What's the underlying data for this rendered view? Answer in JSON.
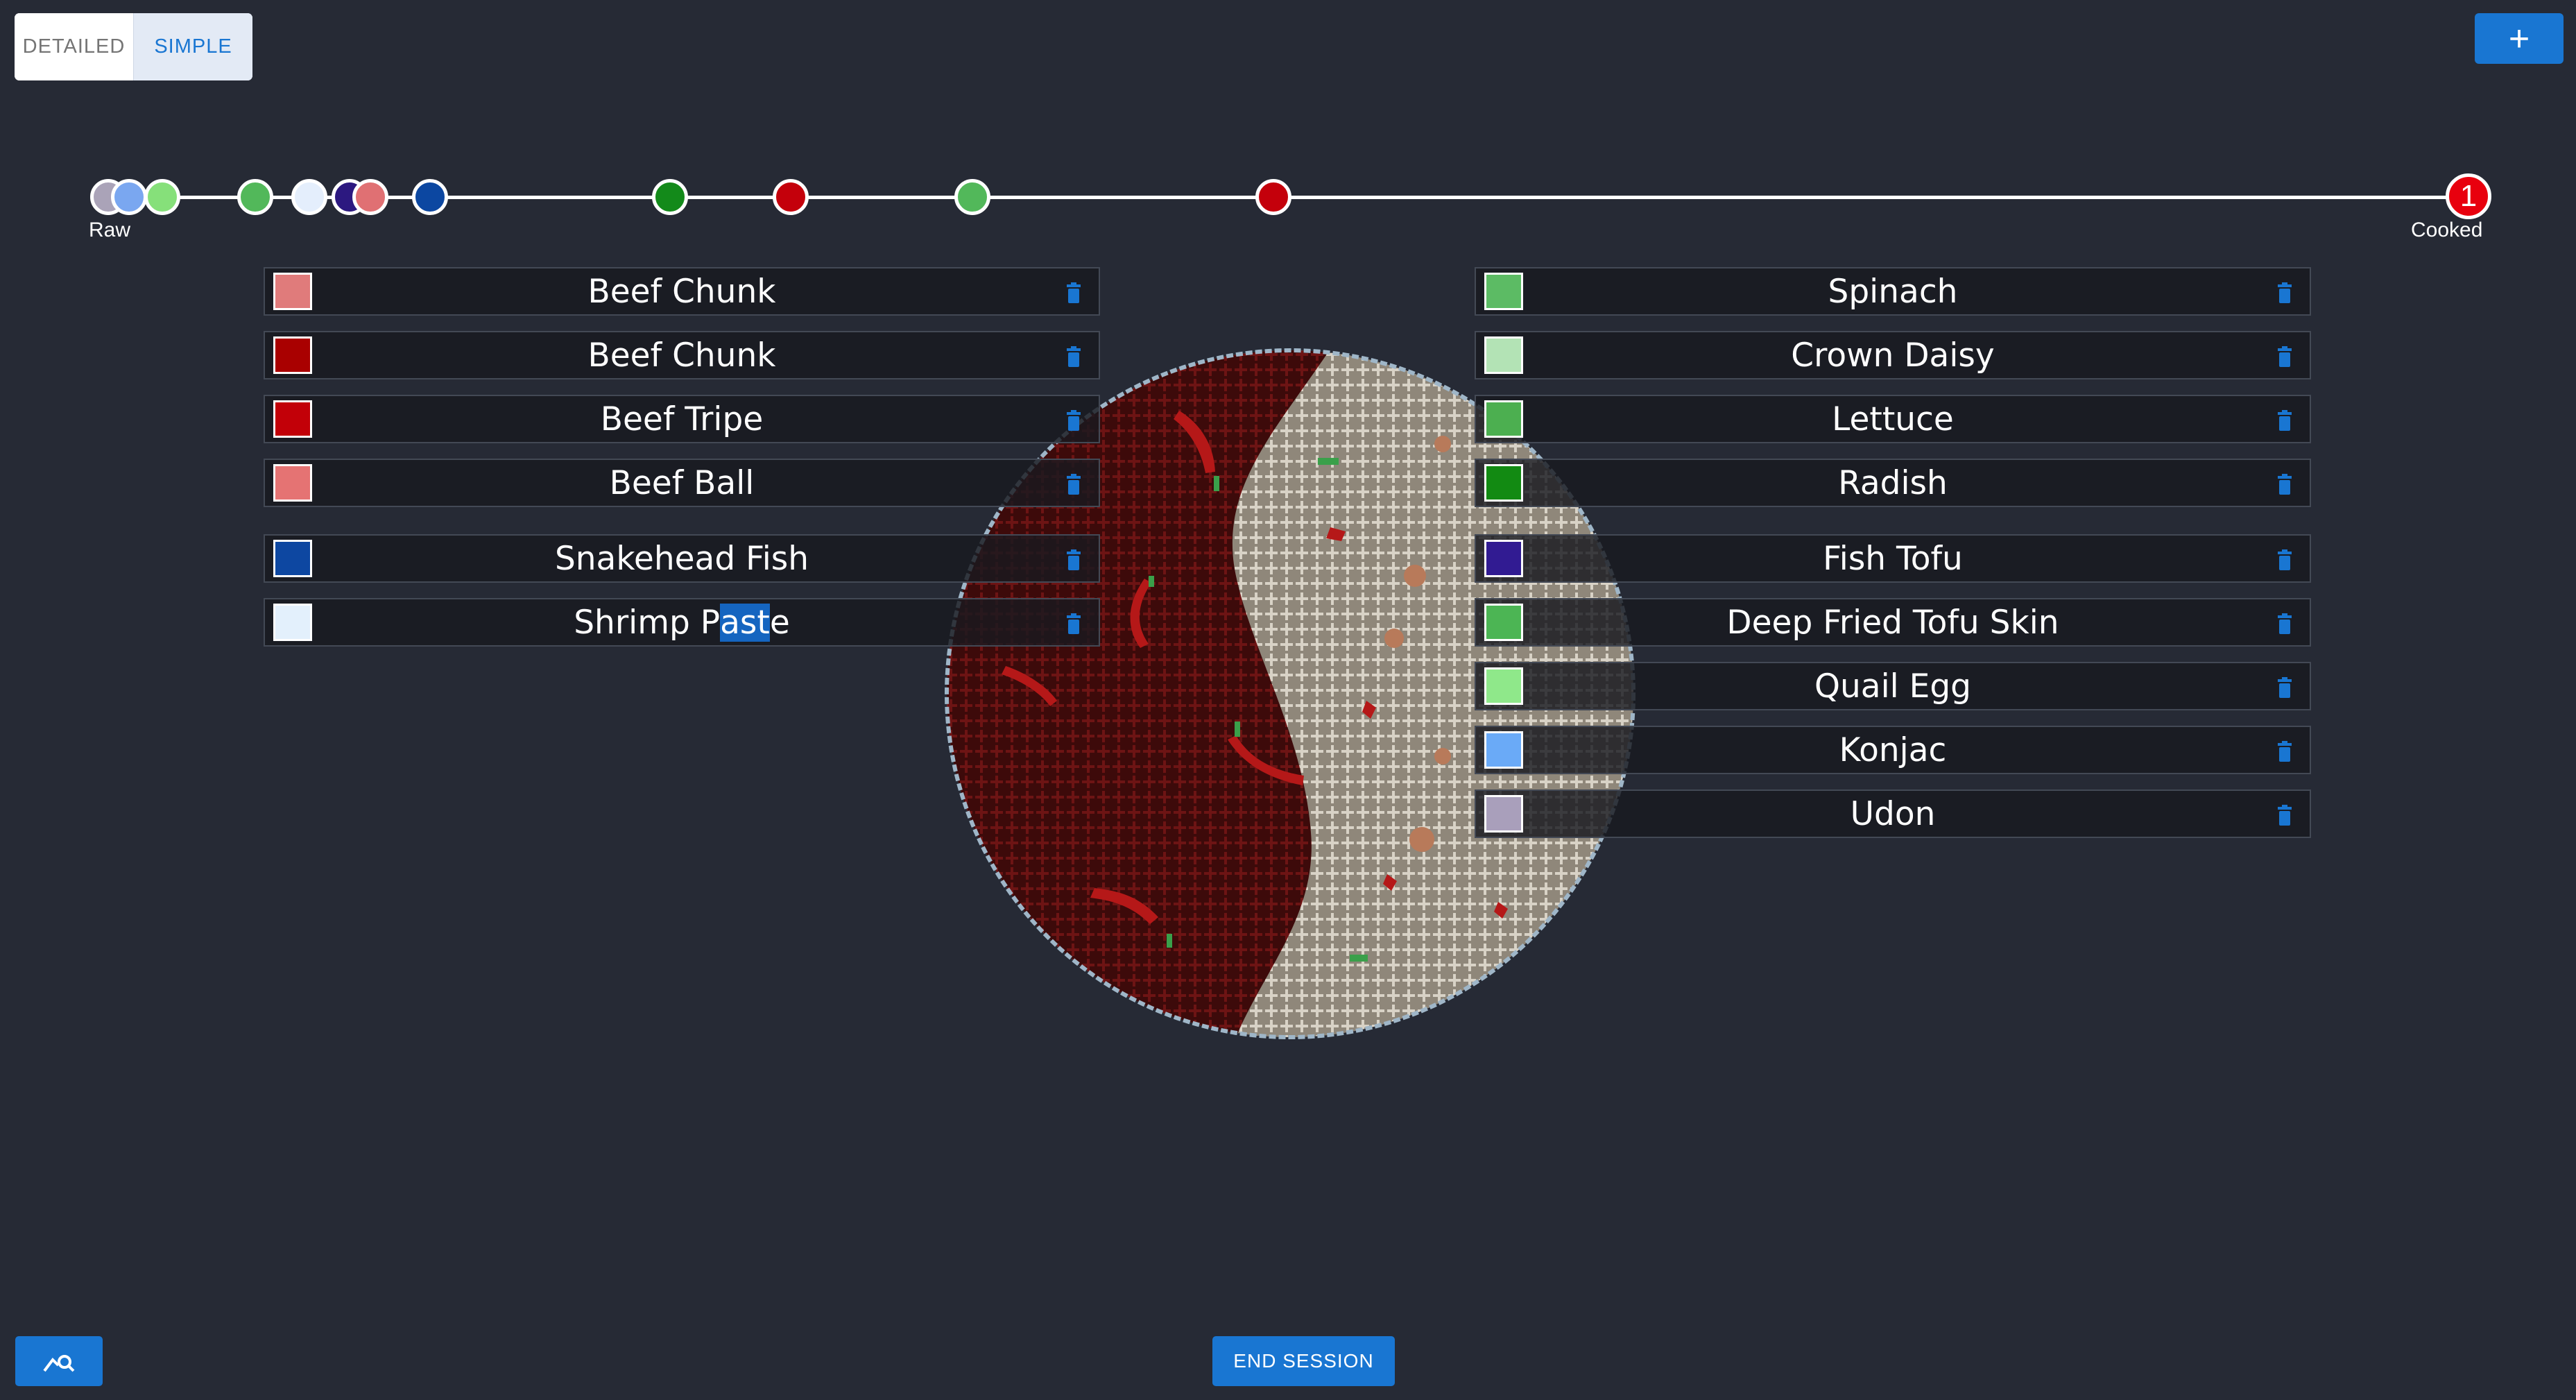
{
  "mode_toggle": {
    "detailed_label": "DETAILED",
    "simple_label": "SIMPLE",
    "selected": "SIMPLE"
  },
  "add_button": {
    "label": "+"
  },
  "timeline": {
    "start_label": "Raw",
    "end_label": "Cooked",
    "end_count": "1",
    "dots": [
      {
        "color": "#aaa3b8"
      },
      {
        "color": "#7aa7f0"
      },
      {
        "color": "#86e07a"
      },
      {
        "color": "#52b85a"
      },
      {
        "color": "#e4eefc"
      },
      {
        "color": "#2c1880"
      },
      {
        "color": "#e07073"
      },
      {
        "color": "#0c47a1"
      },
      {
        "color": "#138a1a"
      },
      {
        "color": "#c4000b"
      },
      {
        "color": "#52b85a"
      },
      {
        "color": "#c4000b"
      }
    ]
  },
  "left_ingredients": [
    {
      "name": "Beef Chunk",
      "color": "#e07b7b"
    },
    {
      "name": "Beef Chunk",
      "color": "#a90000"
    },
    {
      "name": "Beef Tripe",
      "color": "#c20008"
    },
    {
      "name": "Beef Ball",
      "color": "#e57373"
    },
    {
      "name": "Snakehead Fish",
      "color": "#0d47a1"
    },
    {
      "name_pre": "Shrimp P",
      "name_sel": "ast",
      "name_post": "e",
      "color": "#e3f0fc"
    }
  ],
  "right_ingredients": [
    {
      "name": "Spinach",
      "color": "#5cbb64"
    },
    {
      "name": "Crown Daisy",
      "color": "#b3e3b5"
    },
    {
      "name": "Lettuce",
      "color": "#4caf50"
    },
    {
      "name": "Radish",
      "color": "#128a12"
    },
    {
      "name": "Fish Tofu",
      "color": "#311b92"
    },
    {
      "name": "Deep Fried Tofu Skin",
      "color": "#4cb554"
    },
    {
      "name": "Quail Egg",
      "color": "#8fe88a"
    },
    {
      "name": "Konjac",
      "color": "#6aaaf7"
    },
    {
      "name": "Udon",
      "color": "#a99fbb"
    }
  ],
  "footer": {
    "end_session_label": "END SESSION",
    "analytics_icon": "chart-search-icon"
  },
  "icons": {
    "delete": "trash-icon"
  },
  "colors": {
    "accent": "#1976d2",
    "background": "#262a35",
    "cooked_red": "#e8000e"
  }
}
